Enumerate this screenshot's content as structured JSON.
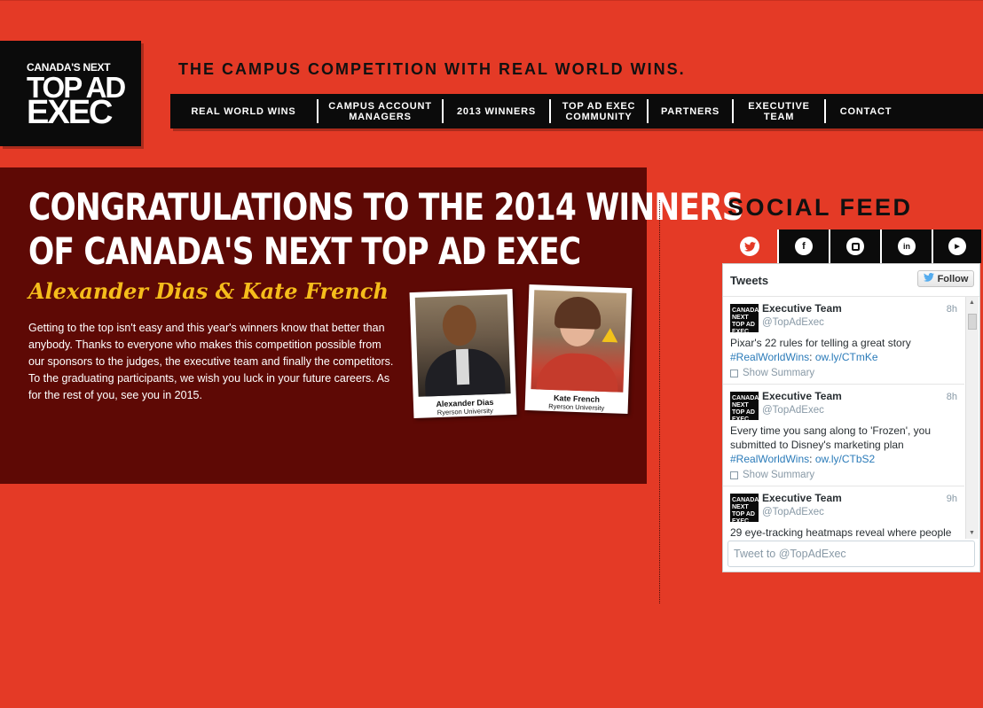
{
  "logo": {
    "line1": "CANADA'S NEXT",
    "line2": "TOP AD",
    "line3": "EXEC"
  },
  "tagline": "THE CAMPUS COMPETITION WITH REAL WORLD WINS.",
  "nav": [
    "REAL WORLD WINS",
    "CAMPUS ACCOUNT\nMANAGERS",
    "2013 WINNERS",
    "TOP AD EXEC\nCOMMUNITY",
    "PARTNERS",
    "EXECUTIVE\nTEAM",
    "CONTACT"
  ],
  "hero": {
    "headline_line1": "CONGRATULATIONS TO THE 2014 WINNERS",
    "headline_line2": "OF CANADA'S NEXT TOP AD EXEC",
    "winners": "Alexander Dias & Kate French",
    "body": "Getting to the top isn't easy and this year's winners know that better than anybody. Thanks to everyone who makes this competition possible from our sponsors to the judges, the executive team and finally the competitors. To the graduating participants, we wish you luck in your future careers. As for the rest of you, see you in 2015.",
    "photos": [
      {
        "name": "Alexander Dias",
        "school": "Ryerson University"
      },
      {
        "name": "Kate French",
        "school": "Ryerson University"
      }
    ]
  },
  "social": {
    "title": "SOCIAL FEED",
    "tabs": [
      "twitter-icon",
      "facebook-icon",
      "instagram-icon",
      "linkedin-icon",
      "youtube-icon"
    ],
    "widget": {
      "title": "Tweets",
      "follow_label": "Follow",
      "compose_placeholder": "Tweet to @TopAdExec",
      "tweets": [
        {
          "name": "Executive Team",
          "handle": "@TopAdExec",
          "time": "8h",
          "text": "Pixar's 22 rules for telling a great story ",
          "hashtag": "#RealWorldWins",
          "sep": ": ",
          "link": "ow.ly/CTmKe",
          "summary": "Show Summary"
        },
        {
          "name": "Executive Team",
          "handle": "@TopAdExec",
          "time": "8h",
          "text": "Every time you sang along to 'Frozen', you submitted to Disney's marketing plan ",
          "hashtag": "#RealWorldWins",
          "sep": ": ",
          "link": "ow.ly/CTbS2",
          "summary": "Show Summary"
        },
        {
          "name": "Executive Team",
          "handle": "@TopAdExec",
          "time": "9h",
          "text": "29 eye-tracking heatmaps reveal where people",
          "hashtag": "",
          "sep": "",
          "link": "",
          "summary": ""
        }
      ]
    }
  },
  "colors": {
    "background": "#e43a26",
    "hero": "#5e0905",
    "accent_yellow": "#f5bd1b",
    "black": "#0b0b0b"
  }
}
